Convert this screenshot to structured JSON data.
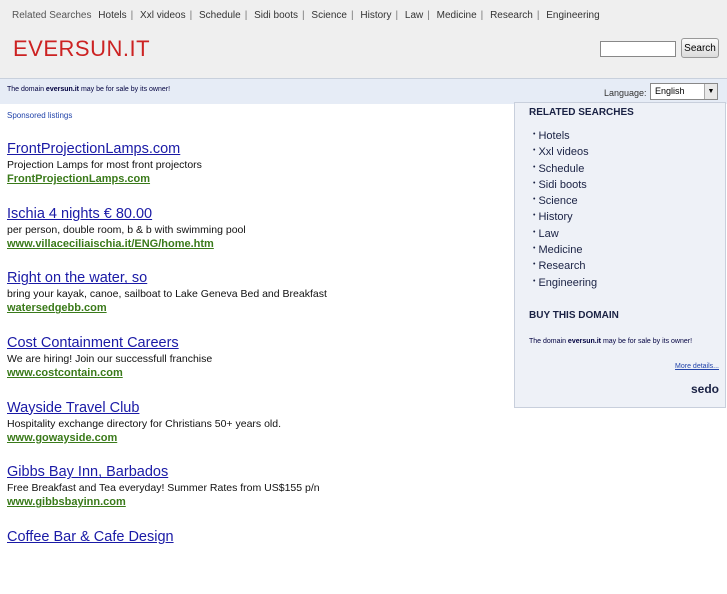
{
  "header": {
    "related_label": "Related Searches",
    "related_links": [
      "Hotels",
      "Xxl videos",
      "Schedule",
      "Sidi boots",
      "Science",
      "History",
      "Law",
      "Medicine",
      "Research",
      "Engineering"
    ],
    "logo": "EVERSUN.IT",
    "search_value": "",
    "search_button": "Search"
  },
  "notice": {
    "prefix": "The domain ",
    "domain": "eversun.it",
    "suffix": " may be for sale by its owner!",
    "language_label": "Language:",
    "language_value": "English"
  },
  "sponsored_label": "Sponsored listings",
  "ads": [
    {
      "title": "FrontProjectionLamps.com",
      "desc": "Projection Lamps for most front projectors",
      "url": "FrontProjectionLamps.com"
    },
    {
      "title": "Ischia 4 nights € 80.00",
      "desc": "per person, double room, b & b with swimming pool",
      "url": "www.villaceciliaischia.it/ENG/home.htm"
    },
    {
      "title": "Right on the water, so",
      "desc": "bring your kayak, canoe, sailboat to Lake Geneva Bed and Breakfast",
      "url": "watersedgebb.com"
    },
    {
      "title": "Cost Containment Careers",
      "desc": "We are hiring! Join our successfull franchise",
      "url": "www.costcontain.com"
    },
    {
      "title": "Wayside Travel Club",
      "desc": "Hospitality exchange directory for Christians 50+ years old.",
      "url": "www.gowayside.com"
    },
    {
      "title": "Gibbs Bay Inn, Barbados",
      "desc": "Free Breakfast and Tea everyday! Summer Rates from US$155 p/n",
      "url": "www.gibbsbayinn.com"
    },
    {
      "title": "Coffee Bar & Cafe Design",
      "desc": "",
      "url": ""
    }
  ],
  "sidebar": {
    "related_heading": "RELATED SEARCHES",
    "items": [
      "Hotels",
      "Xxl videos",
      "Schedule",
      "Sidi boots",
      "Science",
      "History",
      "Law",
      "Medicine",
      "Research",
      "Engineering"
    ],
    "buy_heading": "BUY THIS DOMAIN",
    "buy_prefix": "The domain ",
    "buy_domain": "eversun.it",
    "buy_suffix": " may be for sale by its owner!",
    "more_details": "More details...",
    "brand": "sedo"
  }
}
